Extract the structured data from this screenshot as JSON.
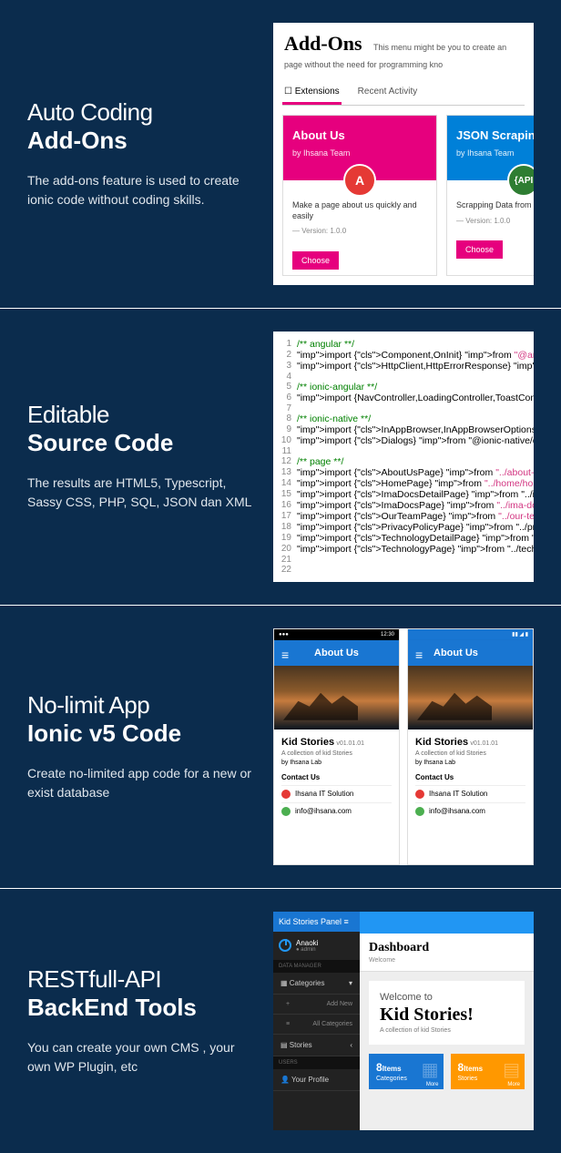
{
  "s1": {
    "title_light": "Auto Coding",
    "title_bold": "Add-Ons",
    "desc": "The add-ons feature is used to create ionic code without coding skills.",
    "header": "Add-Ons",
    "header_sub": "This menu might be you to create an page without the need for programming kno",
    "tab1": "Extensions",
    "tab2": "Recent Activity",
    "c1_title": "About Us",
    "c1_by": "by Ihsana Team",
    "c1_badge": "A",
    "c1_body": "Make a page about us quickly and easily",
    "c1_ver": "— Version: 1.0.0",
    "c2_title": "JSON Scraping",
    "c2_by": "by Ihsana Team",
    "c2_badge": "{API",
    "c2_body": "Scrapping Data from JSON",
    "c2_ver": "— Version: 1.0.0",
    "choose": "Choose"
  },
  "s2": {
    "title_light": "Editable",
    "title_bold": "Source Code",
    "desc": "The results are HTML5, Typescript, Sassy CSS, PHP, SQL, JSON dan XML",
    "code": [
      {
        "n": 1,
        "t": "cmt",
        "v": "/** angular **/"
      },
      {
        "n": 2,
        "t": "imp",
        "v": "import {Component,OnInit} from \"@angular/core\";"
      },
      {
        "n": 3,
        "t": "imp",
        "v": "import {HttpClient,HttpErrorResponse} from \"@ang"
      },
      {
        "n": 4,
        "t": "",
        "v": ""
      },
      {
        "n": 5,
        "t": "cmt",
        "v": "/** ionic-angular **/"
      },
      {
        "n": 6,
        "t": "imp",
        "v": "import {NavController,LoadingController,ToastCont"
      },
      {
        "n": 7,
        "t": "",
        "v": ""
      },
      {
        "n": 8,
        "t": "cmt",
        "v": "/** ionic-native **/"
      },
      {
        "n": 9,
        "t": "imp",
        "v": "import {InAppBrowser,InAppBrowserOptions} from \""
      },
      {
        "n": 10,
        "t": "imp",
        "v": "import {Dialogs} from \"@ionic-native/dialogs/ngx"
      },
      {
        "n": 11,
        "t": "",
        "v": ""
      },
      {
        "n": 12,
        "t": "cmt",
        "v": "/** page **/"
      },
      {
        "n": 13,
        "t": "imp",
        "v": "import {AboutUsPage} from \"../about-us/about-us\""
      },
      {
        "n": 14,
        "t": "imp",
        "v": "import {HomePage} from \"../home/home\";"
      },
      {
        "n": 15,
        "t": "imp",
        "v": "import {ImaDocsDetailPage} from \"../ima-docs/ima"
      },
      {
        "n": 16,
        "t": "imp",
        "v": "import {ImaDocsPage} from \"../ima-docs/ima-docs\""
      },
      {
        "n": 17,
        "t": "imp",
        "v": "import {OurTeamPage} from \"../our-team/our-team\""
      },
      {
        "n": 18,
        "t": "imp",
        "v": "import {PrivacyPolicyPage} from \"../privacy-poli"
      },
      {
        "n": 19,
        "t": "imp",
        "v": "import {TechnologyDetailPage} from \"../technolog"
      },
      {
        "n": 20,
        "t": "imp",
        "v": "import {TechnologyPage} from \"../technology/tech"
      },
      {
        "n": 21,
        "t": "",
        "v": ""
      },
      {
        "n": 22,
        "t": "",
        "v": ""
      }
    ]
  },
  "s3": {
    "title_light": "No-limit App",
    "title_bold": "Ionic v5 Code",
    "desc": "Create no-limited app code for a new or exist database",
    "app_title": "About Us",
    "time": "12:30",
    "kid_title": "Kid Stories",
    "kid_ver": "v01.01.01",
    "kid_sub": "A collection of kid Stories",
    "kid_by": "by Ihsana Lab",
    "contact": "Contact Us",
    "c1": "Ihsana IT Solution",
    "c2": "info@ihsana.com"
  },
  "s4": {
    "title_light": "RESTfull-API",
    "title_bold": "BackEnd Tools",
    "desc": "You can create your own CMS , your own WP Plugin, etc",
    "brand": "Kid Stories Panel",
    "user": "Anaoki",
    "role": "admin",
    "sec1": "DATA MANAGER",
    "mi_cat": "Categories",
    "mi_add": "Add New",
    "mi_all": "All Categories",
    "mi_stories": "Stories",
    "sec2": "USERS",
    "mi_profile": "Your Profile",
    "dash": "Dashboard",
    "welcome": "Welcome",
    "wt": "Welcome to",
    "wh": "Kid Stories!",
    "ws": "A collection of kid Stories",
    "st1_n": "8",
    "st1_t": "Items",
    "st1_s": "Categories",
    "st2_n": "8",
    "st2_t": "Items",
    "st2_s": "Stories",
    "more": "More"
  }
}
